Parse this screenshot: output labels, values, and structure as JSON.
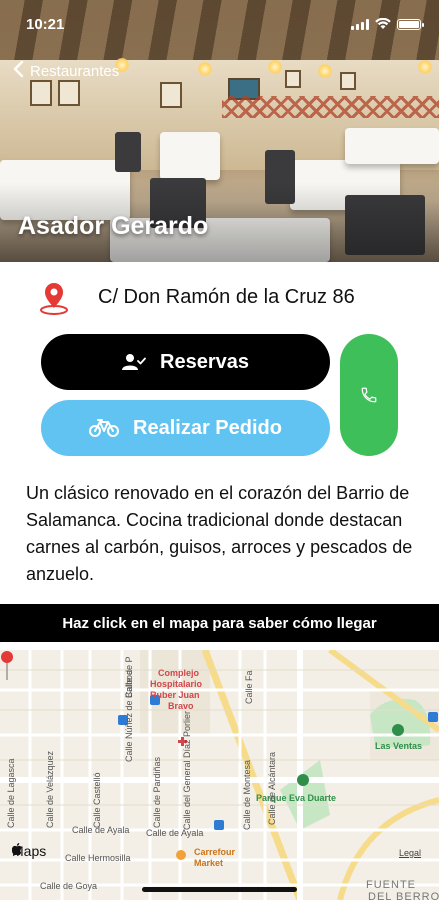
{
  "status": {
    "time": "10:21"
  },
  "nav": {
    "back_label": "Restaurantes"
  },
  "restaurant": {
    "name": "Asador Gerardo",
    "address": "C/ Don Ramón de la Cruz 86",
    "description": "Un clásico renovado en el corazón del Barrio de Salamanca. Cocina tradicional donde destacan carnes al carbón, guisos, arroces y pescados de anzuelo."
  },
  "actions": {
    "reservas_label": "Reservas",
    "pedido_label": "Realizar Pedido",
    "call_icon": "phone-icon"
  },
  "banner": {
    "text": "Haz click en el mapa para saber cómo llegar"
  },
  "map": {
    "attribution": "Maps",
    "legal": "Legal",
    "labels": {
      "complejo": "Complejo",
      "hospitalario": "Hospitalario",
      "ruber": "Ruber Juan",
      "bravo": "Bravo",
      "las_ventas": "Las Ventas",
      "parque": "Parque Eva Duarte",
      "carrefour": "Carrefour",
      "market": "Market",
      "ayala_1": "Calle de Ayala",
      "ayala_2": "Calle de Ayala",
      "hermosilla": "Calle Hermosilla",
      "goya": "Calle de Goya",
      "fuente": "FUENTE",
      "del_berro": "DEL BERRO",
      "alcantara": "Calle de Alcántara",
      "velazquez": "Calle de Velázquez",
      "castello": "Calle Castelló",
      "nunez": "Calle Núñez de Balboa",
      "lagasca": "Calle de Lagasca",
      "pardinas": "Calle de Pardiñas",
      "diaz_porlier": "Calle del General Díaz Porlier",
      "montesa": "Calle de Montesa",
      "calle_de_p": "Calle de P",
      "calle_fa": "Calle Fa"
    }
  },
  "colors": {
    "reservas_bg": "#000000",
    "pedido_bg": "#61c3f2",
    "call_bg": "#3fbf5a",
    "pin": "#e53935",
    "banner_bg": "#000000"
  }
}
